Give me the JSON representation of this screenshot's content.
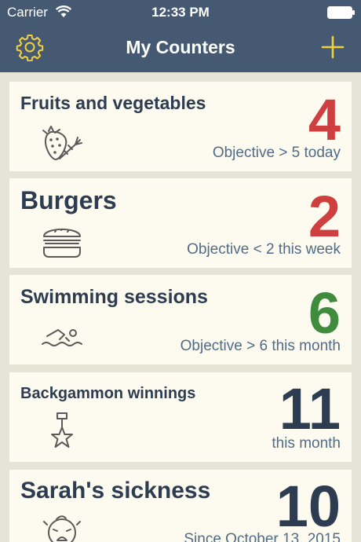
{
  "status_bar": {
    "carrier": "Carrier",
    "time": "12:33 PM"
  },
  "nav": {
    "title": "My Counters",
    "settings_icon": "gear-icon",
    "add_icon": "plus-icon",
    "accent_color": "#f2d13c",
    "bar_color": "#455a72"
  },
  "colors": {
    "below_objective": "#cf3f3f",
    "met_objective": "#3f8c3f",
    "neutral": "#2d3c51"
  },
  "counters": [
    {
      "title": "Fruits and vegetables",
      "count": "4",
      "subtitle": "Objective > 5 today",
      "icon": "strawberry-carrot-icon"
    },
    {
      "title": "Burgers",
      "count": "2",
      "subtitle": "Objective < 2 this week",
      "icon": "burger-icon"
    },
    {
      "title": "Swimming sessions",
      "count": "6",
      "subtitle": "Objective > 6 this month",
      "icon": "swimmer-icon"
    },
    {
      "title": "Backgammon winnings",
      "count": "11",
      "subtitle": "this month",
      "icon": "medal-icon"
    },
    {
      "title": "Sarah's sickness",
      "count": "10",
      "subtitle": "Since October 13, 2015",
      "icon": "crying-baby-icon"
    }
  ]
}
